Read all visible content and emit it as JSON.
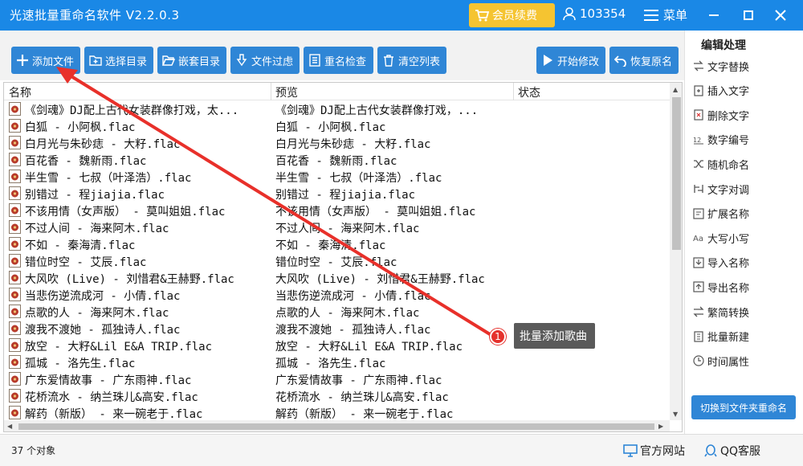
{
  "app": {
    "title": "光速批量重命名软件 V2.2.0.3"
  },
  "titlebar": {
    "vip_label": "会员续费",
    "user_id": "103354",
    "menu_label": "菜单"
  },
  "toolbar": {
    "add_files": "添加文件",
    "select_dir": "选择目录",
    "nested_dir": "嵌套目录",
    "file_filter": "文件过虑",
    "dup_check": "重名检查",
    "clear_list": "清空列表",
    "start": "开始修改",
    "restore": "恢复原名"
  },
  "list": {
    "columns": {
      "name": "名称",
      "preview": "预览",
      "status": "状态"
    },
    "rows": [
      {
        "name": "《剑魂》DJ配上古代女装群像打戏，太...",
        "preview": "《剑魂》DJ配上古代女装群像打戏，..."
      },
      {
        "name": "白狐 - 小阿枫.flac",
        "preview": "白狐 - 小阿枫.flac"
      },
      {
        "name": "白月光与朱砂痣 - 大籽.flac",
        "preview": "白月光与朱砂痣 - 大籽.flac"
      },
      {
        "name": "百花香 - 魏新雨.flac",
        "preview": "百花香 - 魏新雨.flac"
      },
      {
        "name": "半生雪 - 七叔（叶泽浩）.flac",
        "preview": "半生雪 - 七叔（叶泽浩）.flac"
      },
      {
        "name": "别错过 - 程jiajia.flac",
        "preview": "别错过 - 程jiajia.flac"
      },
      {
        "name": "不该用情（女声版） - 莫叫姐姐.flac",
        "preview": "不该用情（女声版） - 莫叫姐姐.flac"
      },
      {
        "name": "不过人间 - 海来阿木.flac",
        "preview": "不过人间 - 海来阿木.flac"
      },
      {
        "name": "不如 - 秦海清.flac",
        "preview": "不如 - 秦海清.flac"
      },
      {
        "name": "错位时空 - 艾辰.flac",
        "preview": "错位时空 - 艾辰.flac"
      },
      {
        "name": "大风吹 (Live) - 刘惜君&王赫野.flac",
        "preview": "大风吹 (Live) - 刘惜君&王赫野.flac"
      },
      {
        "name": "当悲伤逆流成河 - 小倩.flac",
        "preview": "当悲伤逆流成河 - 小倩.flac"
      },
      {
        "name": "点歌的人 - 海来阿木.flac",
        "preview": "点歌的人 - 海来阿木.flac"
      },
      {
        "name": "渡我不渡她 - 孤独诗人.flac",
        "preview": "渡我不渡她 - 孤独诗人.flac"
      },
      {
        "name": "放空 - 大籽&Lil E&A TRIP.flac",
        "preview": "放空 - 大籽&Lil E&A TRIP.flac"
      },
      {
        "name": "孤城 - 洛先生.flac",
        "preview": "孤城 - 洛先生.flac"
      },
      {
        "name": "广东爱情故事 - 广东雨神.flac",
        "preview": "广东爱情故事 - 广东雨神.flac"
      },
      {
        "name": "花桥流水 - 纳兰珠儿&高安.flac",
        "preview": "花桥流水 - 纳兰珠儿&高安.flac"
      },
      {
        "name": "解药（新版） - 来一碗老于.flac",
        "preview": "解药（新版） - 来一碗老于.flac"
      }
    ]
  },
  "status": {
    "object_count": "37 个对象",
    "official_site": "官方网站",
    "qq_support": "QQ客服"
  },
  "panel": {
    "title": "编辑处理",
    "items": [
      {
        "label": "文字替换",
        "icon": "swap-icon"
      },
      {
        "label": "插入文字",
        "icon": "insert-icon"
      },
      {
        "label": "删除文字",
        "icon": "delete-text-icon"
      },
      {
        "label": "数字编号",
        "icon": "number-icon"
      },
      {
        "label": "随机命名",
        "icon": "shuffle-icon"
      },
      {
        "label": "文字对调",
        "icon": "exchange-icon"
      },
      {
        "label": "扩展名称",
        "icon": "extension-icon"
      },
      {
        "label": "大写小写",
        "icon": "case-icon"
      },
      {
        "label": "导入名称",
        "icon": "import-icon"
      },
      {
        "label": "导出名称",
        "icon": "export-icon"
      },
      {
        "label": "繁简转换",
        "icon": "convert-icon"
      },
      {
        "label": "批量新建",
        "icon": "batch-new-icon"
      },
      {
        "label": "时间属性",
        "icon": "clock-icon"
      }
    ],
    "switch_label": "切换到文件夹重命名"
  },
  "annotation": {
    "number": "1",
    "label": "批量添加歌曲"
  },
  "colors": {
    "titlebar": "#1a88e6",
    "button": "#2f86d6",
    "vip": "#f5c431",
    "annotation": "#e5312c"
  }
}
